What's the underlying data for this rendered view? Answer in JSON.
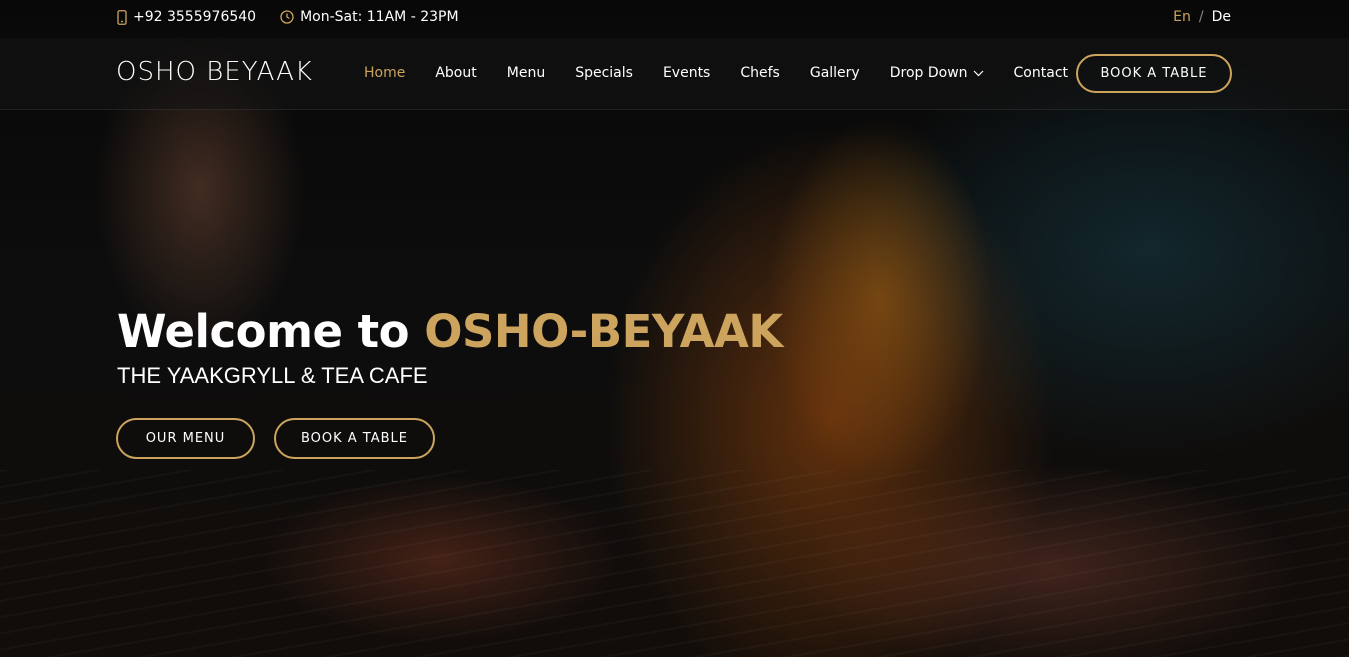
{
  "topbar": {
    "phone": "+92 3555976540",
    "phone_icon": "phone-icon",
    "hours": "Mon-Sat: 11AM - 23PM",
    "hours_icon": "clock-icon",
    "languages": [
      {
        "label": "En",
        "active": true
      },
      {
        "label": "De",
        "active": false
      }
    ],
    "lang_separator": "/"
  },
  "header": {
    "logo": "OSHO BEYAAK",
    "nav": [
      {
        "label": "Home",
        "active": true
      },
      {
        "label": "About"
      },
      {
        "label": "Menu"
      },
      {
        "label": "Specials"
      },
      {
        "label": "Events"
      },
      {
        "label": "Chefs"
      },
      {
        "label": "Gallery"
      },
      {
        "label": "Drop Down",
        "icon": "chevron-down-icon"
      },
      {
        "label": "Contact"
      }
    ],
    "book_button": "BOOK A TABLE"
  },
  "hero": {
    "title_prefix": "Welcome to ",
    "title_brand": "OSHO-BEYAAK",
    "subtitle": "THE YAAKGRYLL & TEA CAFE",
    "menu_button": "OUR MENU",
    "book_button": "BOOK A TABLE"
  },
  "colors": {
    "accent": "#cda45e",
    "text": "#ffffff"
  }
}
